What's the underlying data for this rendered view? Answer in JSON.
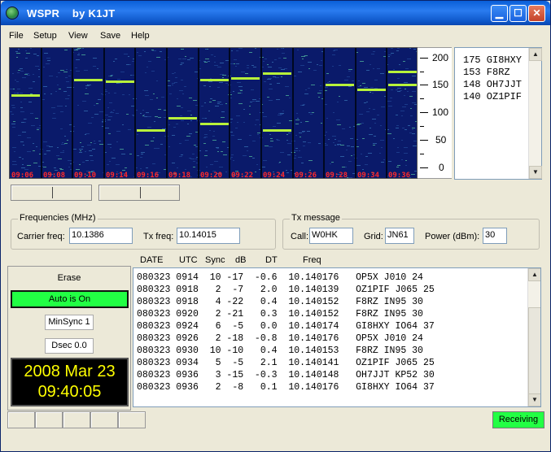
{
  "window": {
    "title": "WSPR    by K1JT",
    "min_glyph": "▁",
    "max_glyph": "☐",
    "close_glyph": "✕"
  },
  "menu": [
    "File",
    "Setup",
    "View",
    "Save",
    "Help"
  ],
  "waterfall": {
    "time_labels": [
      "09:06",
      "09:08",
      "09:10",
      "09:14",
      "09:16",
      "09:18",
      "09:20",
      "09:22",
      "09:24",
      "09:26",
      "09:28",
      "09:34",
      "09:36"
    ],
    "y_ticks": [
      "200",
      "150",
      "100",
      "50",
      "0"
    ],
    "background_color": "#0a1a6a",
    "trace_color": "#b8f23a",
    "label_color": "#ff2a2a"
  },
  "calls": [
    "175 GI8HXY",
    "153 F8RZ",
    "148 OH7JJT",
    "140 OZ1PIF"
  ],
  "frequencies": {
    "title": "Frequencies (MHz)",
    "carrier_label": "Carrier freq:",
    "carrier_value": "10.1386",
    "tx_label": "Tx freq:",
    "tx_value": "10.14015"
  },
  "tx_message": {
    "title": "Tx message",
    "call_label": "Call:",
    "call_value": "W0HK",
    "grid_label": "Grid:",
    "grid_value": "JN61",
    "power_label": "Power (dBm):",
    "power_value": "30"
  },
  "controls": {
    "erase": "Erase",
    "auto": "Auto is On",
    "minsync": "MinSync  1",
    "dsec": "Dsec  0.0",
    "date": "2008 Mar 23",
    "time": "09:40:05"
  },
  "table": {
    "headers": [
      "DATE",
      "UTC",
      "Sync",
      "dB",
      "DT",
      "Freq"
    ],
    "rows": [
      "080323 0914  10 -17  -0.6  10.140176   OP5X J010 24",
      "080323 0918   2  -7   2.0  10.140139   OZ1PIF J065 25",
      "080323 0918   4 -22   0.4  10.140152   F8RZ IN95 30",
      "080323 0920   2 -21   0.3  10.140152   F8RZ IN95 30",
      "080323 0924   6  -5   0.0  10.140174   GI8HXY IO64 37",
      "080323 0926   2 -18  -0.8  10.140176   OP5X J010 24",
      "080323 0930  10 -10   0.4  10.140153   F8RZ IN95 30",
      "080323 0934   5  -5   2.1  10.140141   OZ1PIF J065 25",
      "080323 0936   3 -15  -0.3  10.140148   OH7JJT KP52 30",
      "080323 0936   2  -8   0.1  10.140176   GI8HXY IO64 37"
    ]
  },
  "status": {
    "receiving": "Receiving"
  }
}
